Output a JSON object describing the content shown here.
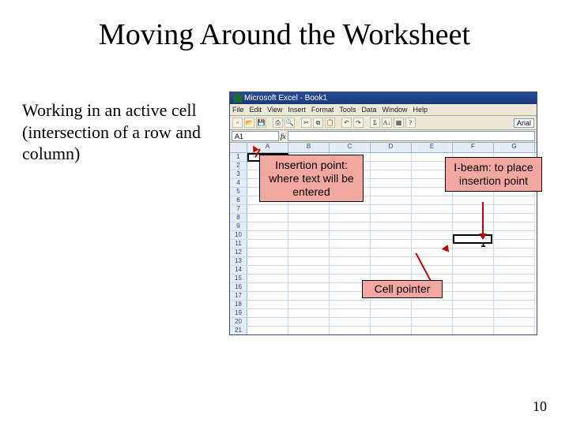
{
  "title": "Moving Around the Worksheet",
  "left_paragraph": "Working in an active cell (intersection of a row and column)",
  "excel": {
    "titlebar": "Microsoft Excel - Book1",
    "menus": [
      "File",
      "Edit",
      "View",
      "Insert",
      "Format",
      "Tools",
      "Data",
      "Window",
      "Help"
    ],
    "font_name": "Arial",
    "namebox": "A1",
    "fx_label": "fx",
    "columns": [
      "A",
      "B",
      "C",
      "D",
      "E",
      "F",
      "G"
    ],
    "row_count": 21
  },
  "callouts": {
    "insertion": "Insertion point: where text will be entered",
    "ibeam": "I-beam: to place insertion point",
    "cellpointer": "Cell pointer"
  },
  "page_number": "10"
}
